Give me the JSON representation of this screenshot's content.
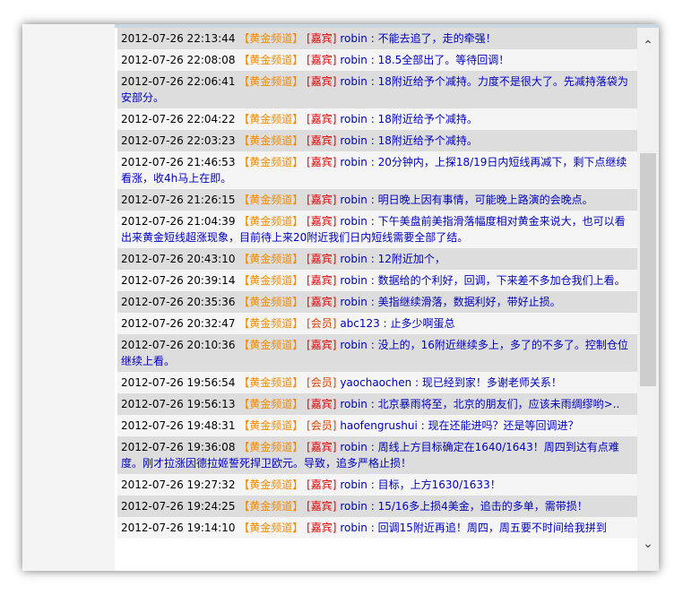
{
  "channel": "【黄金频道】",
  "messages": [
    {
      "time": "2012-07-26 22:13:44",
      "role": "[嘉宾]",
      "user": "robin",
      "text": "不能去追了，走的牵强！"
    },
    {
      "time": "2012-07-26 22:08:08",
      "role": "[嘉宾]",
      "user": "robin",
      "text": "18.5全部出了。等待回调！"
    },
    {
      "time": "2012-07-26 22:06:41",
      "role": "[嘉宾]",
      "user": "robin",
      "text": "18附近给予个减持。力度不是很大了。先减持落袋为安部分。"
    },
    {
      "time": "2012-07-26 22:04:22",
      "role": "[嘉宾]",
      "user": "robin",
      "text": "18附近给予个减持。"
    },
    {
      "time": "2012-07-26 22:03:23",
      "role": "[嘉宾]",
      "user": "robin",
      "text": "18附近给予个减持。"
    },
    {
      "time": "2012-07-26 21:46:53",
      "role": "[嘉宾]",
      "user": "robin",
      "text": "20分钟内，上探18/19日内短线再减下，剩下点继续看涨，收4h马上在即。"
    },
    {
      "time": "2012-07-26 21:26:15",
      "role": "[嘉宾]",
      "user": "robin",
      "text": "明日晚上因有事情，可能晚上路演的会晚点。"
    },
    {
      "time": "2012-07-26 21:04:39",
      "role": "[嘉宾]",
      "user": "robin",
      "text": "下午美盘前美指滑落幅度相对黄金来说大，也可以看出来黄金短线超涨现象，目前待上来20附近我们日内短线需要全部了结。"
    },
    {
      "time": "2012-07-26 20:43:10",
      "role": "[嘉宾]",
      "user": "robin",
      "text": "12附近加个，"
    },
    {
      "time": "2012-07-26 20:39:14",
      "role": "[嘉宾]",
      "user": "robin",
      "text": "数据给的个利好，回调，下来差不多加仓我们上看。"
    },
    {
      "time": "2012-07-26 20:35:36",
      "role": "[嘉宾]",
      "user": "robin",
      "text": "美指继续滑落，数据利好，带好止损。"
    },
    {
      "time": "2012-07-26 20:32:47",
      "role": "[会员]",
      "user": "abc123",
      "text": "止多少啊蛋总"
    },
    {
      "time": "2012-07-26 20:10:36",
      "role": "[嘉宾]",
      "user": "robin",
      "text": "没上的，16附近继续多上，多了的不多了。控制仓位继续上看。"
    },
    {
      "time": "2012-07-26 19:56:54",
      "role": "[会员]",
      "user": "yaochaochen",
      "text": "现已经到家！多谢老师关系！"
    },
    {
      "time": "2012-07-26 19:56:13",
      "role": "[嘉宾]",
      "user": "robin",
      "text": "北京暴雨将至，北京的朋友们，应该未雨绸缪哟>.."
    },
    {
      "time": "2012-07-26 19:48:31",
      "role": "[会员]",
      "user": "haofengrushui",
      "text": "现在还能进吗？还是等回调进？"
    },
    {
      "time": "2012-07-26 19:36:08",
      "role": "[嘉宾]",
      "user": "robin",
      "text": "周线上方目标确定在1640/1643！周四到达有点难度。刚才拉涨因德拉姬誓死捍卫欧元。导致，追多严格止损！"
    },
    {
      "time": "2012-07-26 19:27:32",
      "role": "[嘉宾]",
      "user": "robin",
      "text": "目标，上方1630/1633！"
    },
    {
      "time": "2012-07-26 19:24:25",
      "role": "[嘉宾]",
      "user": "robin",
      "text": "15/16多上损4美金，追击的多单，需带损！"
    },
    {
      "time": "2012-07-26 19:14:10",
      "role": "[嘉宾]",
      "user": "robin",
      "text": "回调15附近再追！周四，周五要不时间给我拼到"
    }
  ]
}
